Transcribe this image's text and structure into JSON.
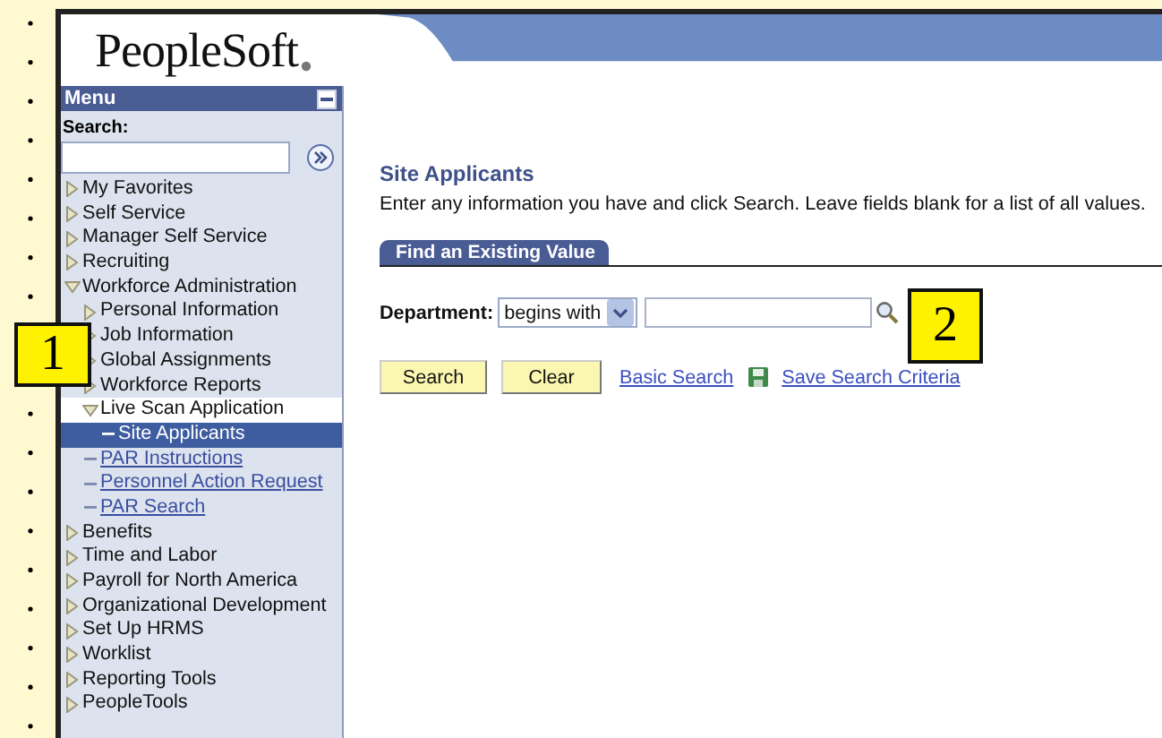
{
  "header": {
    "logo": "PeopleSoft"
  },
  "menu": {
    "title": "Menu",
    "search_label": "Search:",
    "items": [
      {
        "label": "My Favorites",
        "kind": "folder",
        "expanded": false,
        "selected": false
      },
      {
        "label": "Self Service",
        "kind": "folder",
        "expanded": false,
        "selected": false
      },
      {
        "label": "Manager Self Service",
        "kind": "folder",
        "expanded": false,
        "selected": false
      },
      {
        "label": "Recruiting",
        "kind": "folder",
        "expanded": false,
        "selected": false
      },
      {
        "label": "Workforce Administration",
        "kind": "folder",
        "expanded": true,
        "selected": false,
        "children": [
          {
            "label": "Personal Information",
            "kind": "folder",
            "expanded": false,
            "selected": false
          },
          {
            "label": "Job Information",
            "kind": "folder",
            "expanded": false,
            "selected": false
          },
          {
            "label": "Global Assignments",
            "kind": "folder",
            "expanded": false,
            "selected": false
          },
          {
            "label": "Workforce Reports",
            "kind": "folder",
            "expanded": false,
            "selected": false
          },
          {
            "label": "Live Scan Application",
            "kind": "folder",
            "expanded": true,
            "selected": false,
            "children": [
              {
                "label": "Site Applicants",
                "kind": "link",
                "selected": true
              }
            ]
          },
          {
            "label": "PAR Instructions",
            "kind": "link",
            "selected": false
          },
          {
            "label": "Personnel Action Request",
            "kind": "link",
            "selected": false
          },
          {
            "label": "PAR Search",
            "kind": "link",
            "selected": false
          }
        ]
      },
      {
        "label": "Benefits",
        "kind": "folder",
        "expanded": false,
        "selected": false
      },
      {
        "label": "Time and Labor",
        "kind": "folder",
        "expanded": false,
        "selected": false
      },
      {
        "label": "Payroll for North America",
        "kind": "folder",
        "expanded": false,
        "selected": false
      },
      {
        "label": "Organizational Development",
        "kind": "folder",
        "expanded": false,
        "selected": false
      },
      {
        "label": "Set Up HRMS",
        "kind": "folder",
        "expanded": false,
        "selected": false
      },
      {
        "label": "Worklist",
        "kind": "folder",
        "expanded": false,
        "selected": false
      },
      {
        "label": "Reporting Tools",
        "kind": "folder",
        "expanded": false,
        "selected": false
      },
      {
        "label": "PeopleTools",
        "kind": "folder",
        "expanded": false,
        "selected": false
      }
    ]
  },
  "page": {
    "title": "Site Applicants",
    "instructions": "Enter any information you have and click Search. Leave fields blank for a list of all values.",
    "tabs": [
      {
        "label": "Find an Existing Value",
        "selected": true
      }
    ],
    "field": {
      "label": "Department:",
      "operator": "begins with"
    },
    "buttons": [
      "Search",
      "Clear"
    ],
    "links": [
      "Basic Search",
      "Save Search Criteria"
    ]
  },
  "callouts": [
    "1",
    "2"
  ]
}
